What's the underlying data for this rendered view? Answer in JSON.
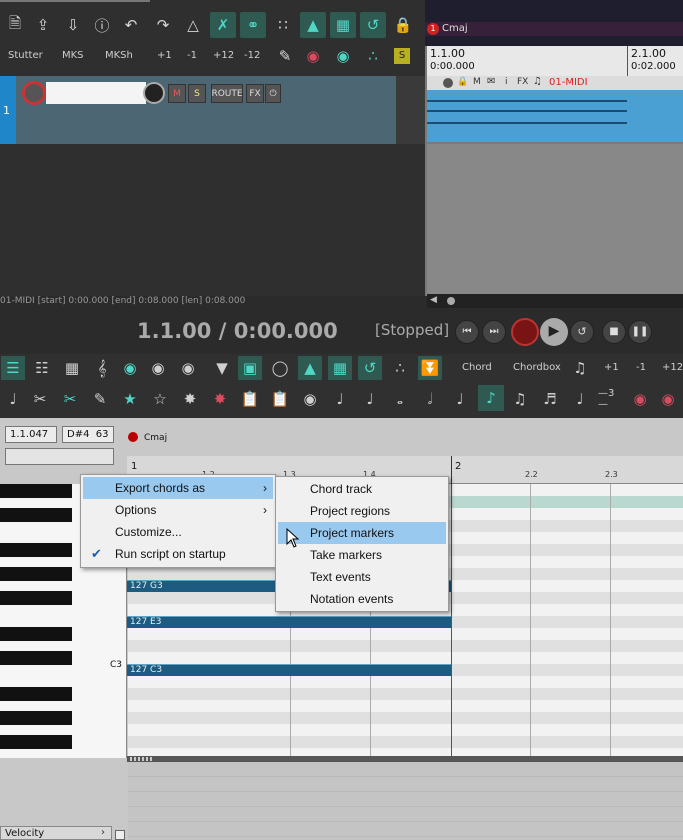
{
  "toolbar": {
    "labels": [
      "Stutter",
      "MKS",
      "MKSh",
      "+1",
      "-1",
      "+12",
      "-12"
    ],
    "s_badge": "S"
  },
  "track": {
    "number": "1",
    "buttons": {
      "mute": "M",
      "solo": "S",
      "route": "ROUTE",
      "fx": "FX"
    }
  },
  "arrange": {
    "region_badge": "1",
    "region_name": "Cmaj",
    "ruler": [
      {
        "bar": "1.1.00",
        "time": "0:00.000"
      },
      {
        "bar": "2.1.00",
        "time": "0:02.000"
      }
    ],
    "item_name": "01-MIDI",
    "item_buttons": [
      "M",
      "i",
      "FX"
    ]
  },
  "status": {
    "item_info": "01-MIDI [start] 0:00.000 [end] 0:08.000 [len] 0:08.000"
  },
  "transport": {
    "position": "1.1.00 / 0:00.000",
    "state": "[Stopped]"
  },
  "midi_toolbar": {
    "labels": [
      "Chord",
      "Chordbox",
      "+1",
      "-1",
      "+12"
    ]
  },
  "midi_editor": {
    "position_box": "1.1.047",
    "note_box": "D#4  63",
    "chord_marker": "Cmaj",
    "ruler_ticks": [
      "1",
      "1.2",
      "1.3",
      "1.4",
      "2",
      "2.2",
      "2.3"
    ],
    "c3_label": "C3",
    "notes": [
      {
        "label": "127 G3"
      },
      {
        "label": "127 E3"
      },
      {
        "label": "127 C3"
      }
    ],
    "cc_lane": "Velocity"
  },
  "context_menu": {
    "items": [
      {
        "label": "Export chords as",
        "submenu": true,
        "checked": false
      },
      {
        "label": "Options",
        "submenu": true,
        "checked": false
      },
      {
        "label": "Customize...",
        "submenu": false,
        "checked": false
      },
      {
        "label": "Run script on startup",
        "submenu": false,
        "checked": true
      }
    ]
  },
  "submenu": {
    "items": [
      {
        "label": "Chord track"
      },
      {
        "label": "Project regions"
      },
      {
        "label": "Project markers",
        "highlighted": true
      },
      {
        "label": "Take markers"
      },
      {
        "label": "Text events"
      },
      {
        "label": "Notation events"
      }
    ]
  },
  "colors": {
    "accent_teal": "#2e5a52",
    "track_blue": "#4a9fd3",
    "note_blue": "#1d5b80",
    "menu_highlight": "#99c9ef",
    "record_red": "#cc2a2a"
  }
}
